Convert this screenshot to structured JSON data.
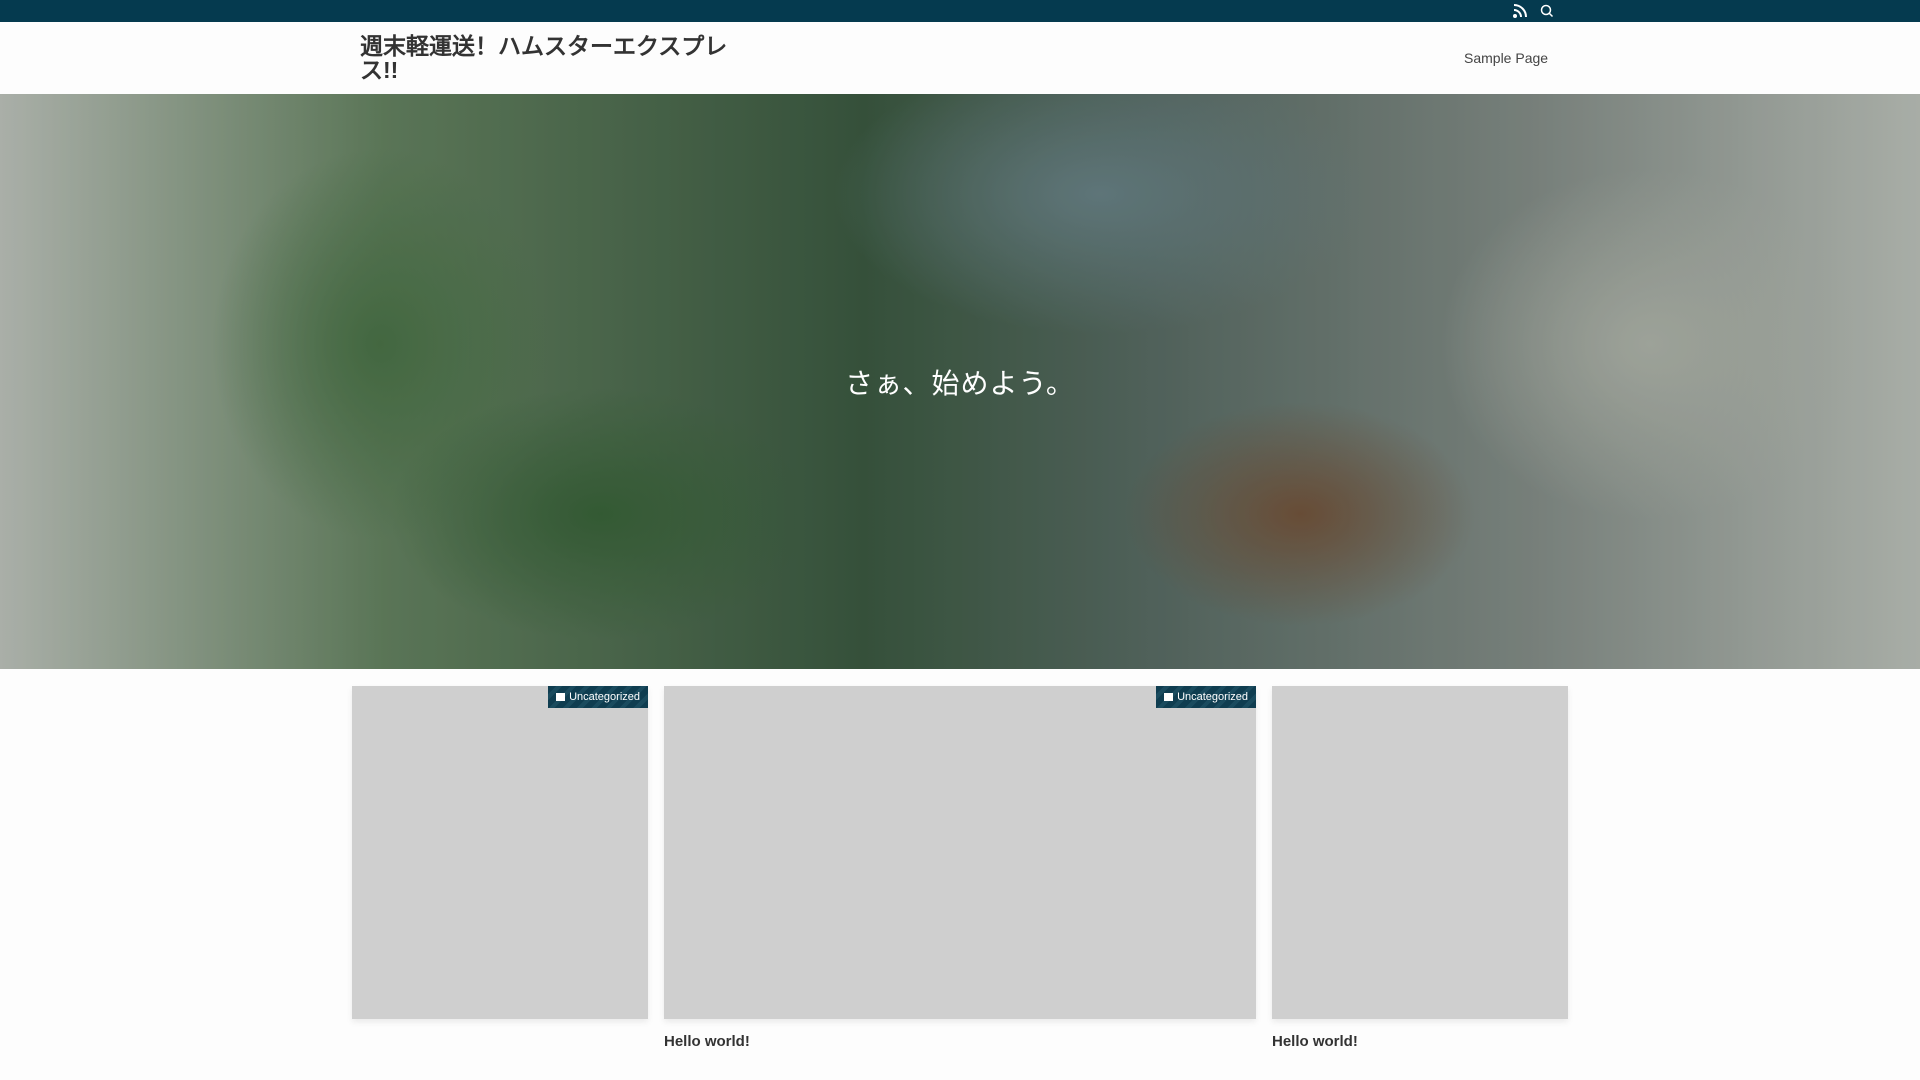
{
  "topbar": {
    "icons": [
      "rss-icon",
      "search-icon"
    ]
  },
  "header": {
    "site_title": "週末軽運送！ハムスターエクスプレス!!",
    "nav": [
      "Sample Page"
    ]
  },
  "hero": {
    "tagline": "さぁ、始めよう。"
  },
  "posts": [
    {
      "category": "Uncategorized",
      "title": ""
    },
    {
      "category": "Uncategorized",
      "title": "Hello world!"
    },
    {
      "category": "",
      "title": "Hello world!"
    }
  ],
  "colors": {
    "topbar": "#053a4f",
    "card_placeholder": "#cfcfcf"
  }
}
